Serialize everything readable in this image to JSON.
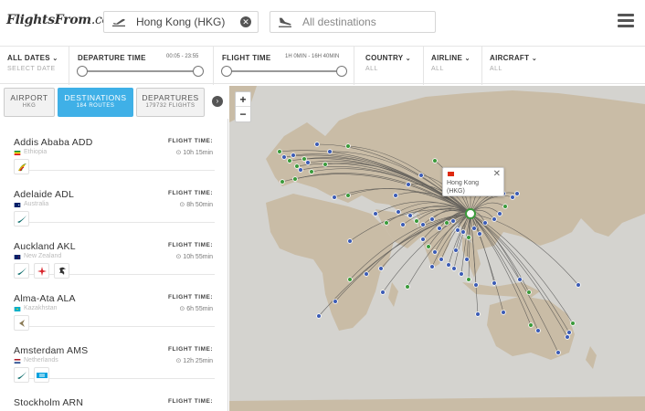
{
  "header": {
    "logo_main": "FlightsFrom",
    "logo_suffix": ".com",
    "from_value": "Hong Kong (HKG)",
    "to_placeholder": "All destinations"
  },
  "filters": {
    "all_dates": "ALL DATES",
    "all_dates_sub": "SELECT DATE",
    "departure_time": "DEPARTURE TIME",
    "departure_range": "00:05 - 23:55",
    "flight_time": "FLIGHT TIME",
    "flight_time_range": "1H 0MIN - 16H 40MIN",
    "country": "COUNTRY",
    "country_sub": "ALL",
    "airline": "AIRLINE",
    "airline_sub": "ALL",
    "aircraft": "AIRCRAFT",
    "aircraft_sub": "ALL"
  },
  "tabs": [
    {
      "label": "AIRPORT",
      "sub": "HKG"
    },
    {
      "label": "DESTINATIONS",
      "sub": "184 ROUTES"
    },
    {
      "label": "DEPARTURES",
      "sub": "179732 FLIGHTS"
    }
  ],
  "destinations": [
    {
      "name": "Addis Ababa ADD",
      "country": "Ethiopia",
      "flight_time_label": "FLIGHT TIME:",
      "flight_time": "10h 15min",
      "airlines": [
        "ethiopian-logo"
      ]
    },
    {
      "name": "Adelaide ADL",
      "country": "Australia",
      "flight_time_label": "FLIGHT TIME:",
      "flight_time": "8h 50min",
      "airlines": [
        "cathay-logo"
      ]
    },
    {
      "name": "Auckland AKL",
      "country": "New Zealand",
      "flight_time_label": "FLIGHT TIME:",
      "flight_time": "10h 55min",
      "airlines": [
        "cathay-logo",
        "airnz-logo",
        "hkairlines-logo"
      ]
    },
    {
      "name": "Alma-Ata ALA",
      "country": "Kazakhstan",
      "flight_time_label": "FLIGHT TIME:",
      "flight_time": "6h 55min",
      "airlines": [
        "airastana-logo"
      ]
    },
    {
      "name": "Amsterdam AMS",
      "country": "Netherlands",
      "flight_time_label": "FLIGHT TIME:",
      "flight_time": "12h 25min",
      "airlines": [
        "cathay-logo",
        "klm-logo"
      ]
    },
    {
      "name": "Stockholm ARN",
      "country": "",
      "flight_time_label": "FLIGHT TIME:",
      "flight_time": "",
      "airlines": []
    }
  ],
  "map": {
    "popup_text": "Hong Kong\n(HKG)",
    "zoom_in": "+",
    "zoom_out": "−",
    "land_color": "#c9bca6",
    "sea_color": "#d4d3cf",
    "route_color": "#444444"
  }
}
